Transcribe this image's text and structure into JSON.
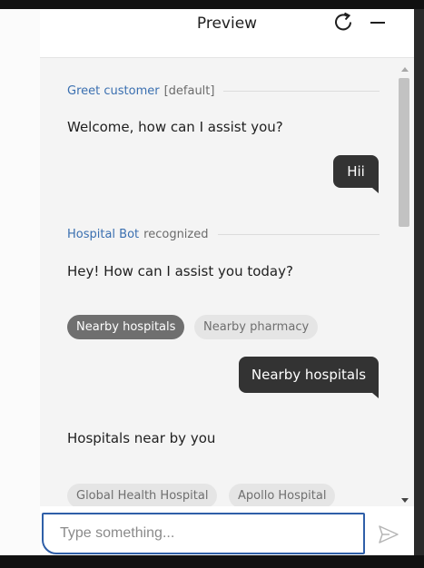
{
  "header": {
    "title": "Preview",
    "refresh_icon": "refresh-icon",
    "minimize_icon": "minimize-icon"
  },
  "chat": {
    "greet": {
      "accent": "Greet customer",
      "muted": "[default]"
    },
    "greet_message": "Welcome, how can I assist you?",
    "user_message_1": "Hii",
    "recognized": {
      "accent": "Hospital Bot",
      "muted": "recognized"
    },
    "bot_message_2": "Hey! How can I assist you today?",
    "options_1": [
      "Nearby hospitals",
      "Nearby pharmacy"
    ],
    "selected_option": "Nearby hospitals",
    "user_message_2": "Nearby hospitals",
    "bot_message_3": "Hospitals near by you",
    "options_2": [
      "Global Health Hospital",
      "Apollo Hospital"
    ]
  },
  "input": {
    "placeholder": "Type something...",
    "value": "",
    "send_icon": "send-icon"
  },
  "colors": {
    "accent_blue": "#3a6fb0",
    "user_bubble": "#333333",
    "chip_selected": "#6f6f6f",
    "chip_plain": "#e5e5e5",
    "input_border": "#2f5fa8"
  }
}
